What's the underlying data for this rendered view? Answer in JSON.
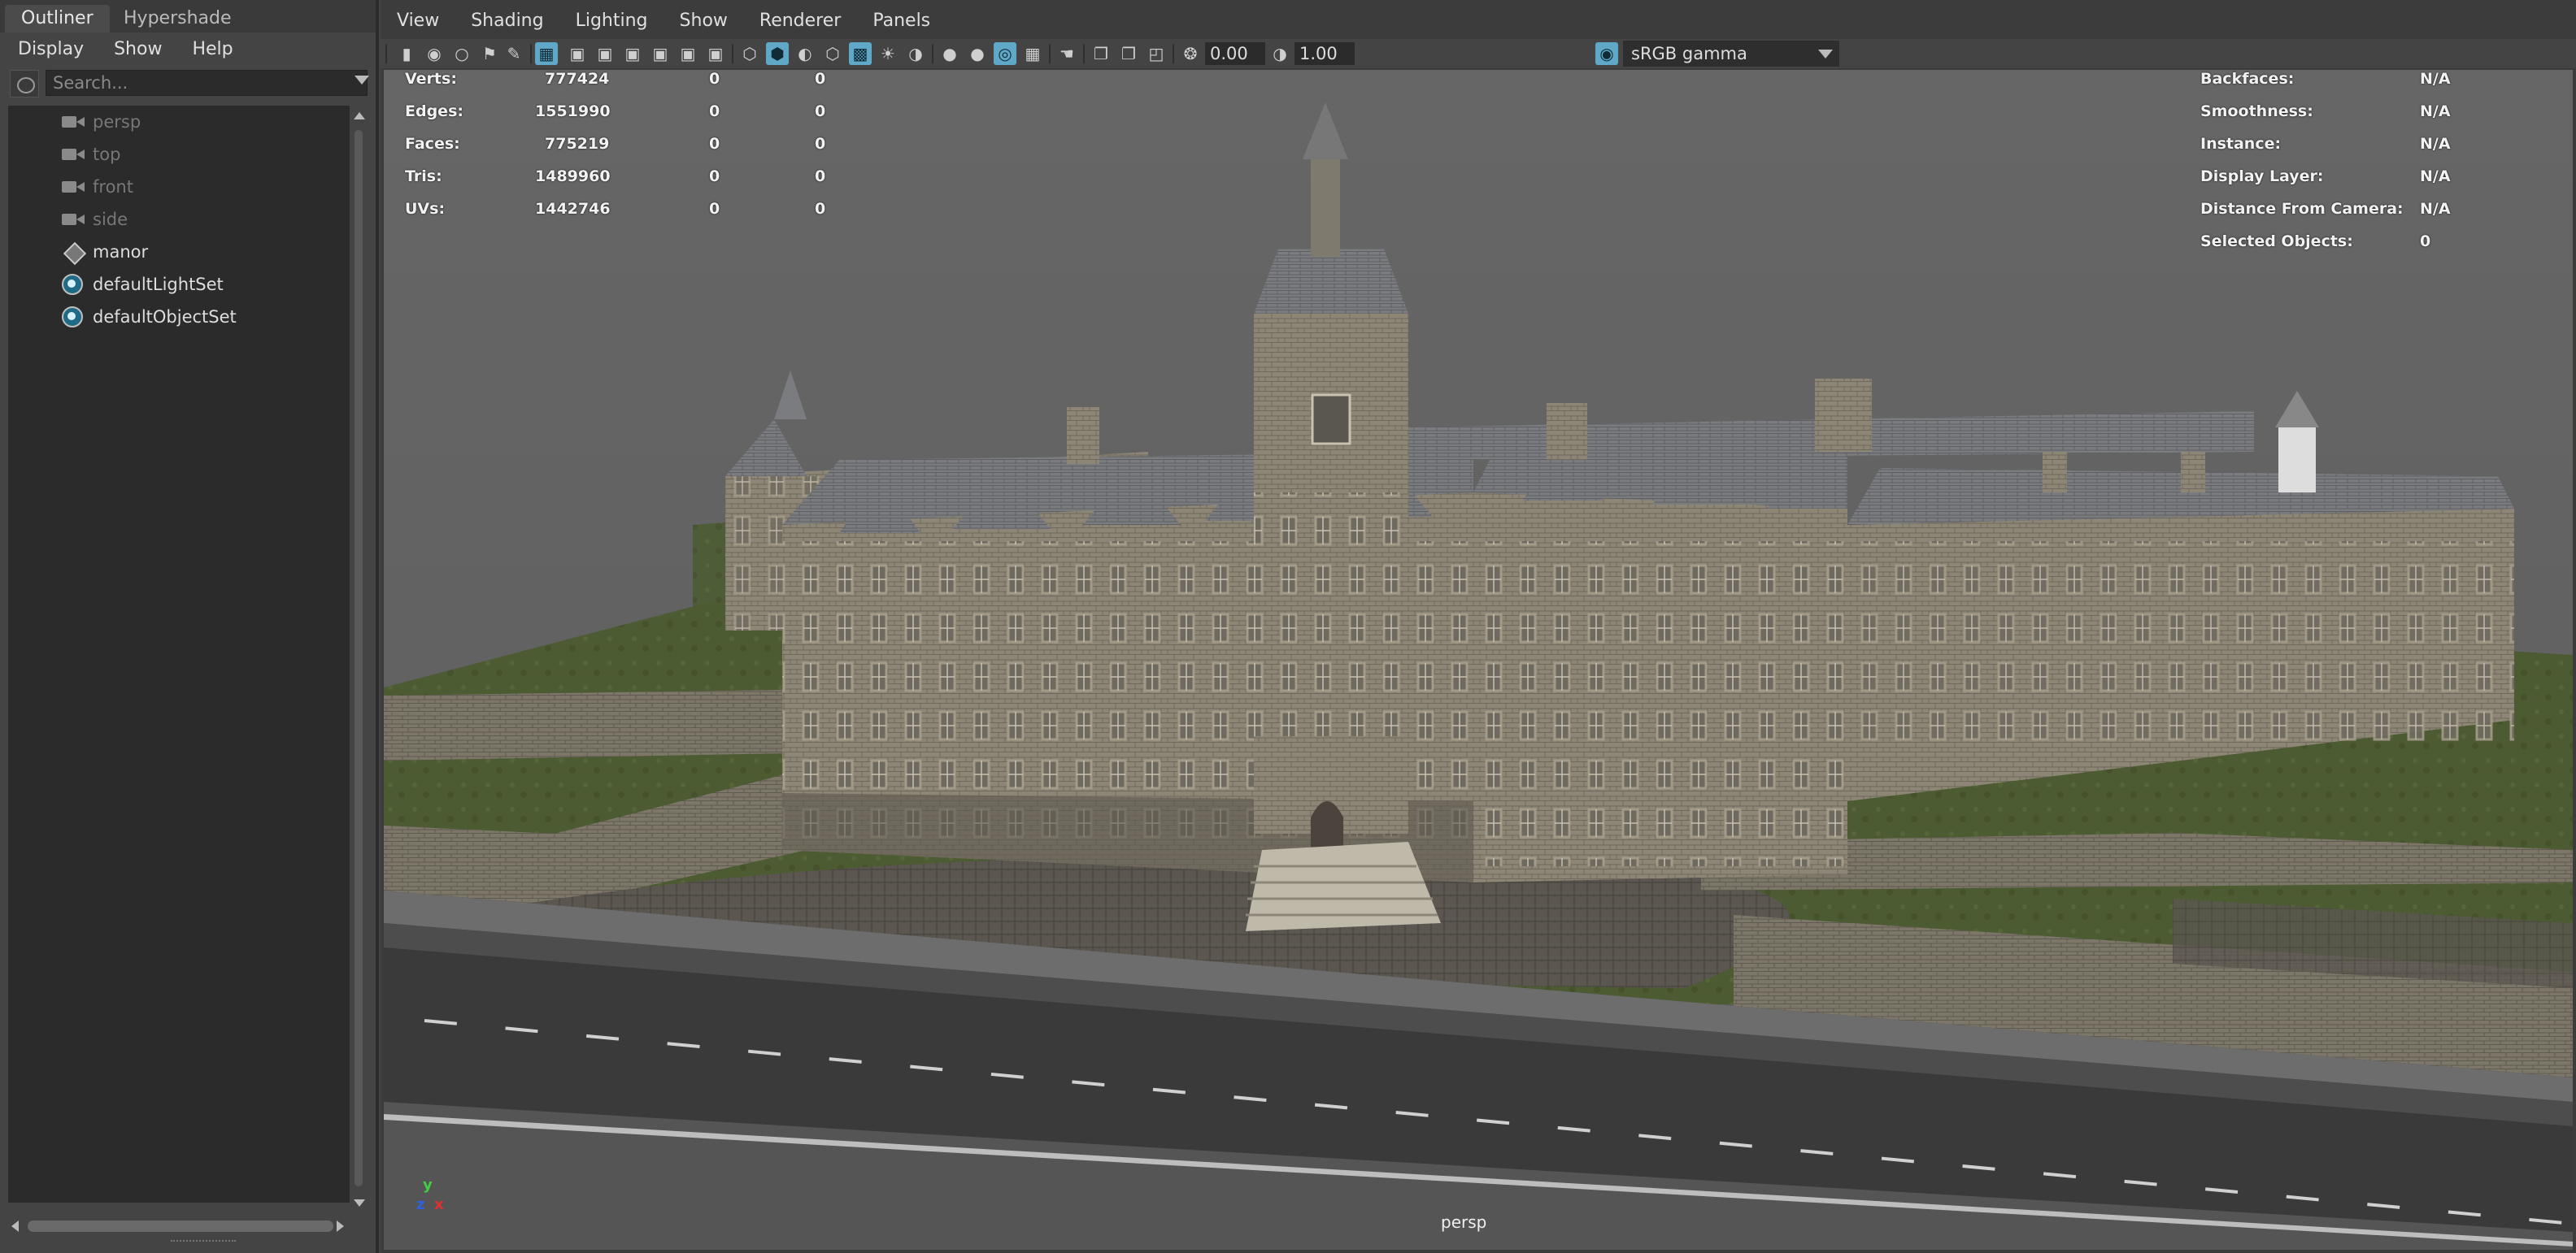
{
  "outliner": {
    "tabs": [
      {
        "label": "Outliner"
      },
      {
        "label": "Hypershade"
      }
    ],
    "menu": [
      {
        "label": "Display"
      },
      {
        "label": "Show"
      },
      {
        "label": "Help"
      }
    ],
    "search_placeholder": "Search...",
    "items": [
      {
        "label": "persp",
        "icon": "camera-icon"
      },
      {
        "label": "top",
        "icon": "camera-icon"
      },
      {
        "label": "front",
        "icon": "camera-icon"
      },
      {
        "label": "side",
        "icon": "camera-icon"
      },
      {
        "label": "manor",
        "icon": "mesh-transform-icon"
      },
      {
        "label": "defaultLightSet",
        "icon": "set-icon"
      },
      {
        "label": "defaultObjectSet",
        "icon": "set-icon"
      }
    ]
  },
  "viewport": {
    "menu": [
      {
        "label": "View"
      },
      {
        "label": "Shading"
      },
      {
        "label": "Lighting"
      },
      {
        "label": "Show"
      },
      {
        "label": "Renderer"
      },
      {
        "label": "Panels"
      }
    ],
    "exposure": "0.00",
    "gamma": "1.00",
    "color_space": "sRGB gamma",
    "camera_name": "persp",
    "axis": {
      "y": "y",
      "z": "z",
      "x": "x"
    },
    "stats": [
      {
        "label": "Verts:",
        "values": [
          "777424",
          "0",
          "0"
        ]
      },
      {
        "label": "Edges:",
        "values": [
          "1551990",
          "0",
          "0"
        ]
      },
      {
        "label": "Faces:",
        "values": [
          "775219",
          "0",
          "0"
        ]
      },
      {
        "label": "Tris:",
        "values": [
          "1489960",
          "0",
          "0"
        ]
      },
      {
        "label": "UVs:",
        "values": [
          "1442746",
          "0",
          "0"
        ]
      }
    ],
    "info": [
      {
        "label": "Backfaces:",
        "value": "N/A"
      },
      {
        "label": "Smoothness:",
        "value": "N/A"
      },
      {
        "label": "Instance:",
        "value": "N/A"
      },
      {
        "label": "Display Layer:",
        "value": "N/A"
      },
      {
        "label": "Distance From Camera:",
        "value": "N/A"
      },
      {
        "label": "Selected Objects:",
        "value": "0"
      }
    ]
  },
  "colors": {
    "panel_bg": "#444444",
    "viewport_bg": "#646464",
    "highlight": "#5fa8c8",
    "axis_x": "#e03030",
    "axis_y": "#40d040",
    "axis_z": "#3060e0"
  }
}
